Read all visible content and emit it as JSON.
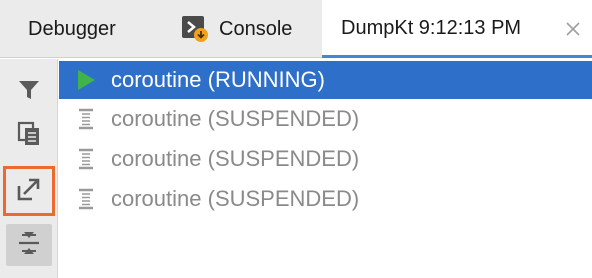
{
  "tabs": [
    {
      "label": "Debugger"
    },
    {
      "label": "Console",
      "icon": "console-icon"
    },
    {
      "label": "DumpKt 9:12:13 PM",
      "active": true
    }
  ],
  "sidebar": [
    {
      "icon": "filter-icon"
    },
    {
      "icon": "copy-icon"
    },
    {
      "icon": "export-icon",
      "highlighted": true
    },
    {
      "icon": "collapse-icon",
      "pressed": true
    }
  ],
  "coroutines": [
    {
      "label": "coroutine (RUNNING)",
      "state": "running",
      "selected": true
    },
    {
      "label": "coroutine (SUSPENDED)",
      "state": "suspended"
    },
    {
      "label": "coroutine (SUSPENDED)",
      "state": "suspended"
    },
    {
      "label": "coroutine (SUSPENDED)",
      "state": "suspended"
    }
  ],
  "colors": {
    "selection": "#2e6fca",
    "tab_underline": "#3f88d6",
    "highlight_border": "#ed6a2f",
    "running_icon": "#3fb44a",
    "console_badge": "#f0a21a"
  }
}
